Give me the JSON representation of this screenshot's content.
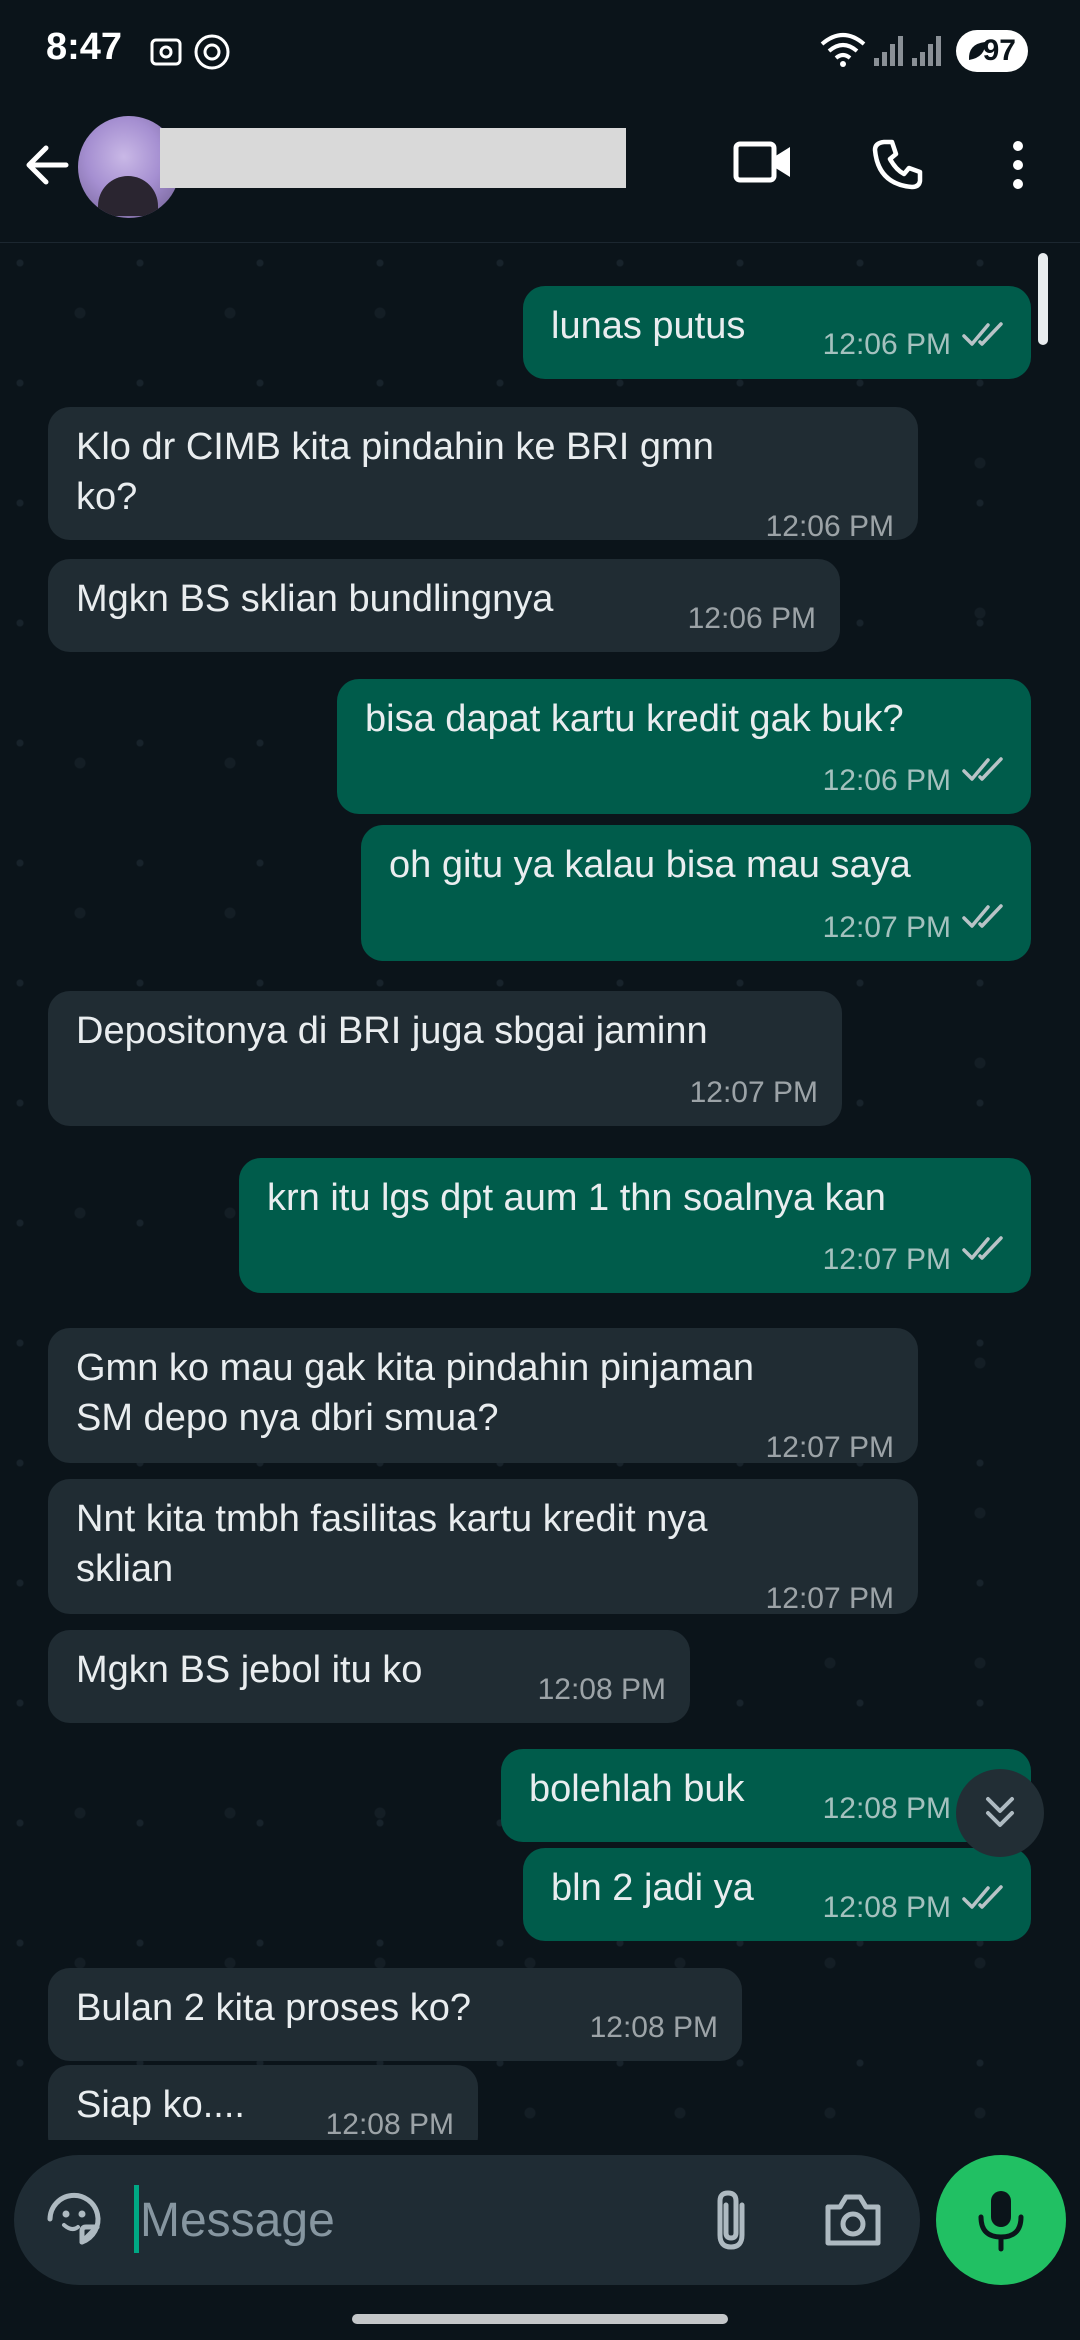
{
  "status_bar": {
    "time": "8:47",
    "battery": "97"
  },
  "contact": {
    "name": ""
  },
  "messages": [
    {
      "dir": "out",
      "text": "lunas putus",
      "time": "12:06 PM"
    },
    {
      "dir": "in",
      "lines": [
        "Klo dr CIMB kita pindahin ke BRI gmn",
        "ko?"
      ],
      "time": "12:06 PM"
    },
    {
      "dir": "in",
      "text": "Mgkn BS sklian bundlingnya",
      "time": "12:06 PM"
    },
    {
      "dir": "out",
      "text": "bisa dapat kartu kredit gak buk?",
      "time": "12:06 PM"
    },
    {
      "dir": "out",
      "text": "oh gitu ya kalau bisa mau saya",
      "time": "12:07 PM"
    },
    {
      "dir": "in",
      "text": "Depositonya di BRI juga sbgai jaminn",
      "time": "12:07 PM"
    },
    {
      "dir": "out",
      "text": "krn itu lgs dpt aum 1 thn soalnya kan",
      "time": "12:07 PM"
    },
    {
      "dir": "in",
      "lines": [
        "Gmn ko mau gak kita pindahin pinjaman",
        "SM depo nya dbri smua?"
      ],
      "time": "12:07 PM"
    },
    {
      "dir": "in",
      "lines": [
        "Nnt kita tmbh fasilitas kartu kredit nya",
        "sklian"
      ],
      "time": "12:07 PM"
    },
    {
      "dir": "in",
      "text": "Mgkn BS jebol itu ko",
      "time": "12:08 PM"
    },
    {
      "dir": "out",
      "text": "bolehlah buk",
      "time": "12:08 PM"
    },
    {
      "dir": "out",
      "text": "bln 2 jadi ya",
      "time": "12:08 PM"
    },
    {
      "dir": "in",
      "text": "Bulan 2 kita proses ko?",
      "time": "12:08 PM"
    },
    {
      "dir": "in",
      "text": "Siap ko....",
      "time": "12:08 PM"
    }
  ],
  "composer": {
    "placeholder": "Message"
  },
  "colors": {
    "background": "#0b141a",
    "incoming": "#202c33",
    "outgoing": "#005c4b",
    "accent": "#21c063"
  },
  "icons": [
    "back-arrow-icon",
    "video-call-icon",
    "phone-call-icon",
    "more-vert-icon",
    "sticker-icon",
    "attach-icon",
    "camera-icon",
    "mic-icon",
    "double-chevron-down-icon",
    "double-check-icon"
  ]
}
